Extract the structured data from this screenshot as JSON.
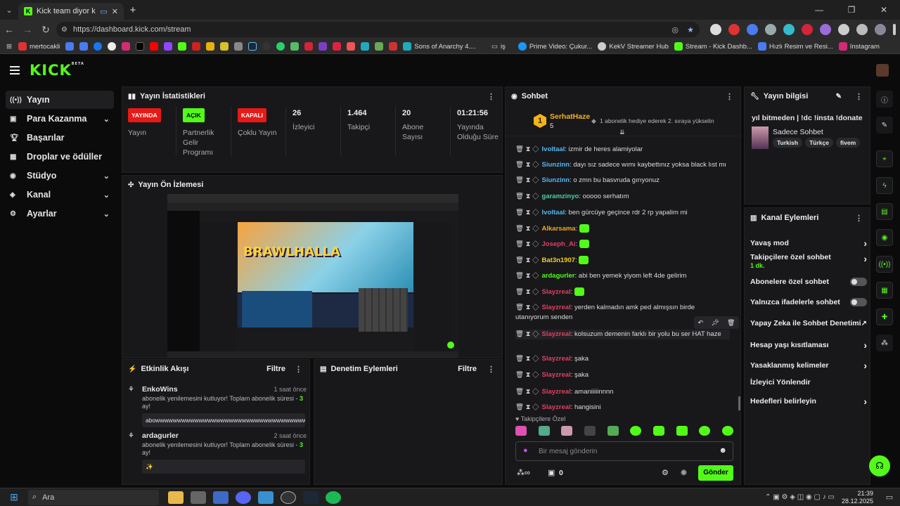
{
  "browser": {
    "tab_title": "Kick team diyor ki...",
    "url": "https://dashboard.kick.com/stream",
    "bookmarks": [
      "mertocakli",
      "Sons of Anarchy 4....",
      "iş",
      "Prime Video: Çukur...",
      "KekV Streamer Hub",
      "Stream - Kick Dashb...",
      "Hızlı Resim ve Resi...",
      "Instagram"
    ]
  },
  "header": {
    "logo": "KICK",
    "beta": "BETA"
  },
  "sidebar": {
    "items": [
      {
        "label": "Yayın",
        "icon": "broadcast-icon"
      },
      {
        "label": "Para Kazanma",
        "icon": "money-icon"
      },
      {
        "label": "Başarılar",
        "icon": "trophy-icon"
      },
      {
        "label": "Droplar ve ödüller",
        "icon": "gift-icon"
      },
      {
        "label": "Stüdyo",
        "icon": "studio-icon"
      },
      {
        "label": "Kanal",
        "icon": "channel-icon"
      },
      {
        "label": "Ayarlar",
        "icon": "gear-icon"
      }
    ]
  },
  "stats": {
    "title": "Yayın İstatistikleri",
    "items": [
      {
        "badge": "YAYINDA",
        "label": "Yayın",
        "color": "#e91916"
      },
      {
        "badge": "AÇIK",
        "label": "Partnerlik Gelir Programı",
        "color": "#53fc18"
      },
      {
        "badge": "KAPALI",
        "label": "Çoklu Yayın",
        "color": "#e91916"
      },
      {
        "value": "26",
        "label": "İzleyici"
      },
      {
        "value": "1.464",
        "label": "Takipçi"
      },
      {
        "value": "20",
        "label": "Abone Sayısı"
      },
      {
        "value": "01:21:56",
        "label": "Yayında Olduğu Süre"
      }
    ]
  },
  "preview": {
    "title": "Yayın Ön İzlemesi",
    "game": "BRAWLHALLA"
  },
  "events": {
    "title": "Etkinlik Akışı",
    "filter": "Filtre",
    "items": [
      {
        "user": "EnkoWins",
        "time": "1 saat önce",
        "text": "abonelik yenilemesini kutluyor! Toplam abonelik süresi -",
        "months": "3",
        "suffix": "ay!",
        "message": "abowwwwwwwwwwwwwwwwwwwwwwwwwwwwwwwwwwwwww"
      },
      {
        "user": "ardagurler",
        "time": "2 saat önce",
        "text": "abonelik yenilemesini kutluyor! Toplam abonelik süresi -",
        "months": "3",
        "suffix": "ay!",
        "message": "✨"
      }
    ]
  },
  "moderation": {
    "title": "Denetim Eylemleri",
    "filter": "Filtre"
  },
  "chat": {
    "title": "Sohbet",
    "pinned_user": "SerhatHaze",
    "pinned_count": "5",
    "pinned_rank": "1",
    "pinned_text": "1 abonelik hediye ederek 2. sıraya yükselin",
    "messages": [
      {
        "user": "Ivoltaal",
        "text": "izmir de heres alamiyolar",
        "color": "#53b8f0"
      },
      {
        "user": "Siunzinn",
        "text": "dayı sız sadece wımı kaybettınız yoksa black lıst mı",
        "color": "#53b8f0"
      },
      {
        "user": "Siunzinn",
        "text": "o zmn bu basvruda gırıyonuz",
        "color": "#53b8f0"
      },
      {
        "user": "garamzinyo",
        "text": "ooooo serhatım",
        "color": "#4ad0a0"
      },
      {
        "user": "Ivoltaal",
        "text": "ben gürcüye geçince rdr 2 rp yapalim mi",
        "color": "#53b8f0"
      },
      {
        "user": "Alkarsama",
        "text": "",
        "color": "#f5a623"
      },
      {
        "user": "Joseph_Ai",
        "text": "",
        "color": "#e0405f"
      },
      {
        "user": "Bat3n1907",
        "text": "",
        "color": "#f5d020"
      },
      {
        "user": "ardagurler",
        "text": "abi ben yemek yiyom left 4de gelirim",
        "color": "#53fc18"
      },
      {
        "user": "Slayzreal",
        "text": "",
        "color": "#e0405f"
      },
      {
        "user": "Slayzreal",
        "text": "yerden kalmadın amk ped almışsın birde utanıyorum senden",
        "color": "#e0405f"
      },
      {
        "user": "Slayzreal",
        "text": "kolsuzum demenin farklı bir yolu bu ser HAT haze",
        "color": "#e0405f"
      },
      {
        "user": "Slayzreal",
        "text": "şaka",
        "color": "#e0405f"
      },
      {
        "user": "Slayzreal",
        "text": "şaka",
        "color": "#e0405f"
      },
      {
        "user": "Slayzreal",
        "text": "amaniiiiinnnn",
        "color": "#e0405f"
      },
      {
        "user": "Slayzreal",
        "text": "hangisini",
        "color": "#e0405f"
      }
    ],
    "follower_label": "Takipçilere Özel",
    "input_placeholder": "Bir mesaj gönderin",
    "points": "0",
    "send": "Gönder"
  },
  "stream_info": {
    "title": "Yayın bilgisi",
    "stream_title": "yıl bitmeden | !dc !insta !donate",
    "category": "Sadece Sohbet",
    "tags": [
      "Turkish",
      "Türkçe",
      "fivem"
    ]
  },
  "channel_actions": {
    "title": "Kanal Eylemleri",
    "items": [
      {
        "label": "Yavaş mod",
        "type": "arrow"
      },
      {
        "label": "Takipçilere özel sohbet",
        "sub": "1 dk.",
        "type": "arrow"
      },
      {
        "label": "Abonelere özel sohbet",
        "type": "toggle"
      },
      {
        "label": "Yalnızca ifadelerle sohbet",
        "type": "toggle"
      },
      {
        "label": "Yapay Zeka ile Sohbet Denetimi",
        "type": "external"
      },
      {
        "label": "Hesap yaşı kısıtlaması",
        "type": "arrow"
      },
      {
        "label": "Yasaklanmış kelimeler",
        "type": "arrow"
      },
      {
        "label": "İzleyici Yönlendir",
        "type": "none"
      },
      {
        "label": "Hedefleri belirleyin",
        "type": "arrow"
      }
    ]
  },
  "taskbar": {
    "search": "Ara",
    "time": "21:39",
    "date": "28.12.2025"
  },
  "colors": {
    "brand": "#53fc18",
    "panel": "#18181b",
    "bg": "#0b0b0c",
    "live": "#e91916"
  }
}
